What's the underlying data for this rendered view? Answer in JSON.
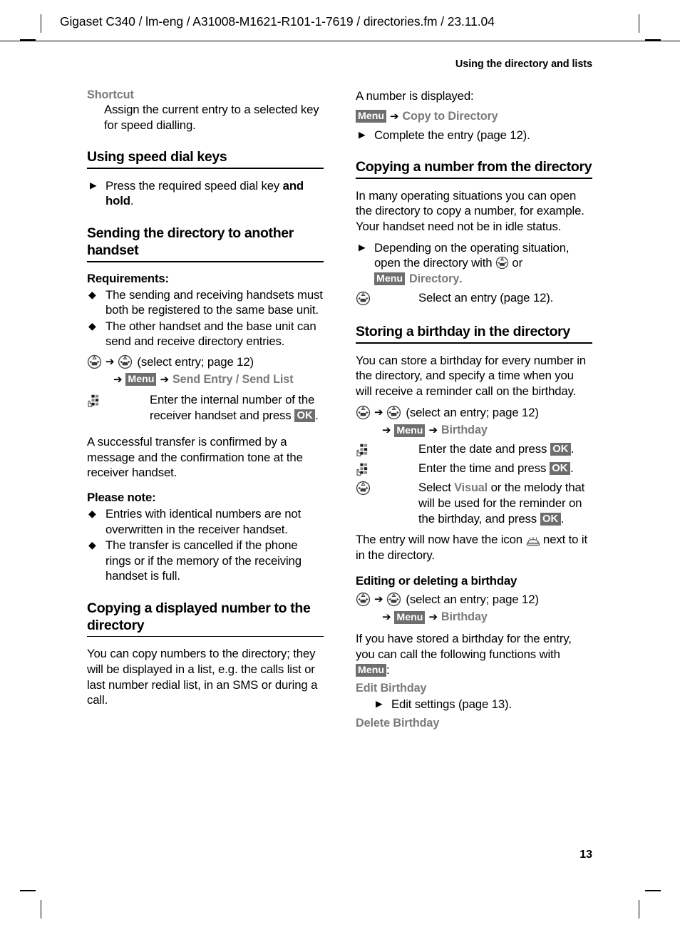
{
  "page": {
    "header_line": "Gigaset C340 / lm-eng / A31008-M1621-R101-1-7619 / directories.fm / 23.11.04",
    "running_head": "Using the directory and lists",
    "folio": "13"
  },
  "keys": {
    "menu": "Menu",
    "ok": "OK",
    "arrow": "➔"
  },
  "left_column": {
    "shortcut": {
      "label": "Shortcut",
      "description": "Assign the current entry to a selected key for speed dialling."
    },
    "speed_dial": {
      "heading": "Using speed dial keys",
      "step_pre": "Press the required speed dial key ",
      "step_bold": "and hold",
      "step_post": "."
    },
    "sending": {
      "heading": "Sending the directory to another handset",
      "requirements_label": "Requirements:",
      "requirements": [
        "The sending and receiving handsets must both be registered to the same base unit.",
        "The other handset and the base unit can send and receive directory entries."
      ],
      "cmd_select": "(select entry; page 12)",
      "cmd_menu_item": "Send Entry / Send List",
      "keypad_step_pre": "Enter the internal number of the receiver handset and press ",
      "keypad_step_post": ".",
      "confirm_text": "A successful transfer is confirmed by a message and the confirmation tone at the receiver handset.",
      "note_label": "Please note:",
      "notes": [
        "Entries with identical numbers are not overwritten in the receiver handset.",
        "The transfer is cancelled if the phone rings or if the memory of the receiving handset is full."
      ]
    },
    "copying_displayed": {
      "heading": "Copying a displayed number to the directory",
      "body": "You can copy numbers to the directory; they will be displayed in a list, e.g. the calls list or last number redial list, in an SMS or during a call."
    }
  },
  "right_column": {
    "number_displayed": {
      "intro": "A number is displayed:",
      "menu_item": "Copy to Directory",
      "step": "Complete the entry (page 12)."
    },
    "copying_from": {
      "heading": "Copying a number from the directory",
      "body": "In many operating situations you can open the directory to copy a number, for example. Your handset need not be in idle status.",
      "step_pre": "Depending on the operating situation, open the directory with ",
      "step_or": " or",
      "step_menu_item": "Directory",
      "step_post": ".",
      "select_step": "Select an entry (page 12)."
    },
    "storing_birthday": {
      "heading": "Storing a birthday in the directory",
      "body": "You can store a birthday for every number in the directory, and specify a time when you will receive a reminder call on the birthday.",
      "cmd_select": "(select an entry; page 12)",
      "cmd_menu_item": "Birthday",
      "step_date_pre": "Enter the date and press ",
      "step_date_post": ".",
      "step_time_pre": "Enter the time and press ",
      "step_time_post": ".",
      "step_visual_pre": "Select ",
      "step_visual_name": "Visual",
      "step_visual_post": " or the melody that will be used for the reminder on the birthday, and press ",
      "step_visual_end": ".",
      "icon_note_pre": "The entry will now have the icon ",
      "icon_note_post": " next to it in the directory."
    },
    "editing_birthday": {
      "heading": "Editing or deleting a birthday",
      "cmd_select": "(select an entry; page 12)",
      "cmd_menu_item": "Birthday",
      "body_pre": "If you have stored a birthday for the entry, you can call the following functions with ",
      "body_post": ":",
      "edit_label": "Edit Birthday",
      "edit_step": "Edit settings (page 13).",
      "delete_label": "Delete Birthday"
    }
  },
  "icons": {
    "nav_key": "navigation-key-icon",
    "keypad": "keypad-digit-keys-icon",
    "birthday_cake": "birthday-cake-icon",
    "bullet_diamond": "◆",
    "bullet_triangle": "▶"
  }
}
